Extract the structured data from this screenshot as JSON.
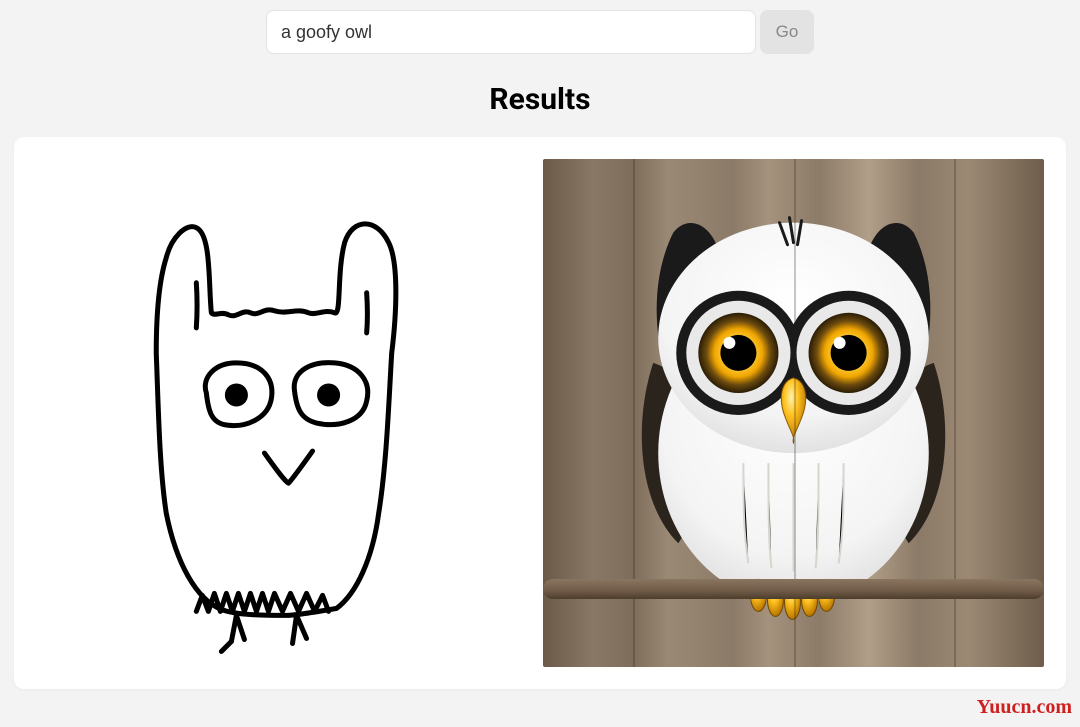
{
  "search": {
    "value": "a goofy owl",
    "go_label": "Go"
  },
  "results": {
    "heading": "Results"
  },
  "watermark": "Yuucn.com"
}
